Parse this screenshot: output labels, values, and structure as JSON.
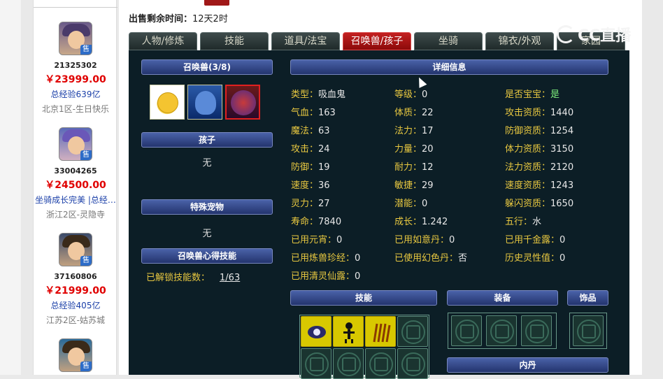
{
  "sale_time": {
    "label": "出售剩余时间：",
    "value": "12天2时"
  },
  "tabs": [
    "人物/修炼",
    "技能",
    "道具/法宝",
    "召唤兽/孩子",
    "坐骑",
    "锦衣/外观",
    "家园"
  ],
  "active_tab_index": 3,
  "sellers": [
    {
      "id": "21325302",
      "price": "￥23999.00",
      "info": "总经验639亿",
      "server": "北京1区-生日快乐",
      "sale_badge": "售"
    },
    {
      "id": "33004265",
      "price": "￥24500.00",
      "info": "坐骑成长完美 |总经…",
      "server": "浙江2区-灵隐寺",
      "sale_badge": "售"
    },
    {
      "id": "37160806",
      "price": "￥21999.00",
      "info": "总经验405亿",
      "server": "江苏2区-姑苏城",
      "sale_badge": "售"
    },
    {
      "sale_badge": "售"
    }
  ],
  "left_panel": {
    "pets_header": "召唤兽(3/8)",
    "child_header": "孩子",
    "child_value": "无",
    "special_header": "特殊宠物",
    "special_value": "无",
    "skill_header": "召唤兽心得技能",
    "unlocked_label": "已解锁技能数：",
    "unlocked_value": "1/63"
  },
  "detail": {
    "header": "详细信息",
    "rows": [
      [
        [
          "类型：",
          "吸血鬼"
        ],
        [
          "等级：",
          "0"
        ],
        [
          "是否宝宝：",
          "是"
        ]
      ],
      [
        [
          "气血：",
          "163"
        ],
        [
          "体质：",
          "22"
        ],
        [
          "攻击资质：",
          "1440"
        ]
      ],
      [
        [
          "魔法：",
          "63"
        ],
        [
          "法力：",
          "17"
        ],
        [
          "防御资质：",
          "1254"
        ]
      ],
      [
        [
          "攻击：",
          "24"
        ],
        [
          "力量：",
          "20"
        ],
        [
          "体力资质：",
          "3150"
        ]
      ],
      [
        [
          "防御：",
          "19"
        ],
        [
          "耐力：",
          "12"
        ],
        [
          "法力资质：",
          "2120"
        ]
      ],
      [
        [
          "速度：",
          "36"
        ],
        [
          "敏捷：",
          "29"
        ],
        [
          "速度资质：",
          "1243"
        ]
      ],
      [
        [
          "灵力：",
          "27"
        ],
        [
          "潜能：",
          "0"
        ],
        [
          "躲闪资质：",
          "1650"
        ]
      ],
      [
        [
          "寿命：",
          "7840"
        ],
        [
          "成长：",
          "1.242"
        ],
        [
          "五行：",
          "水"
        ]
      ],
      [
        [
          "已用元宵：",
          "0"
        ],
        [
          "已用如意丹：",
          "0"
        ],
        [
          "已用千金露：",
          "0"
        ]
      ],
      [
        [
          "已用炼兽珍经：",
          "0"
        ],
        [
          "已使用幻色丹：",
          "否"
        ],
        [
          "历史灵性值：",
          "0"
        ]
      ],
      [
        [
          "已用清灵仙露：",
          "0"
        ],
        null,
        null
      ]
    ]
  },
  "sections": {
    "skills": "技能",
    "equip": "装备",
    "ornament": "饰品",
    "inner": "内丹"
  },
  "watermark": "CC直播",
  "colors": {
    "active_tab": "#c32020",
    "label": "#e8c840",
    "price": "#e00000",
    "panel_bg": "#0c1e26"
  }
}
